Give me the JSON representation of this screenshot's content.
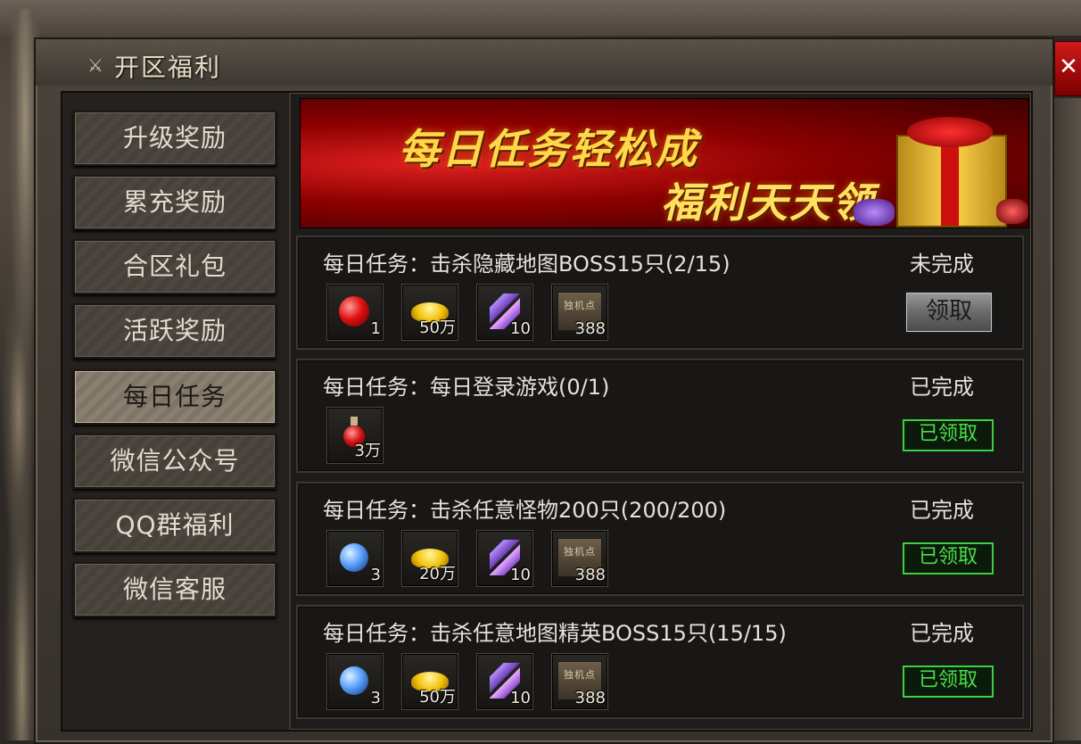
{
  "window": {
    "title": "开区福利",
    "close_label": "✕"
  },
  "sidebar": {
    "items": [
      {
        "label": "升级奖励"
      },
      {
        "label": "累充奖励"
      },
      {
        "label": "合区礼包"
      },
      {
        "label": "活跃奖励"
      },
      {
        "label": "每日任务",
        "active": true
      },
      {
        "label": "微信公众号"
      },
      {
        "label": "QQ群福利"
      },
      {
        "label": "微信客服"
      }
    ]
  },
  "banner": {
    "line1": "每日任务轻松成",
    "line2": "福利天天领"
  },
  "tasks": [
    {
      "title": "每日任务：击杀隐藏地图BOSS15只(2/15)",
      "status": "未完成",
      "button": "领取",
      "claimed": false,
      "rewards": [
        {
          "icon": "red-orb-icon",
          "count": "1"
        },
        {
          "icon": "gold-coins-icon",
          "count": "50万"
        },
        {
          "icon": "purple-scroll-icon",
          "count": "10"
        },
        {
          "icon": "stone-tablet-icon",
          "count": "388",
          "label": "独机点"
        }
      ]
    },
    {
      "title": "每日任务：每日登录游戏(0/1)",
      "status": "已完成",
      "button": "已领取",
      "claimed": true,
      "rewards": [
        {
          "icon": "red-potion-icon",
          "count": "3万"
        }
      ]
    },
    {
      "title": "每日任务：击杀任意怪物200只(200/200)",
      "status": "已完成",
      "button": "已领取",
      "claimed": true,
      "rewards": [
        {
          "icon": "blue-orb-icon",
          "count": "3"
        },
        {
          "icon": "gold-coins-icon",
          "count": "20万"
        },
        {
          "icon": "purple-scroll-icon",
          "count": "10"
        },
        {
          "icon": "stone-tablet-icon",
          "count": "388",
          "label": "独机点"
        }
      ]
    },
    {
      "title": "每日任务：击杀任意地图精英BOSS15只(15/15)",
      "status": "已完成",
      "button": "已领取",
      "claimed": true,
      "rewards": [
        {
          "icon": "blue-orb-icon",
          "count": "3"
        },
        {
          "icon": "gold-coins-icon",
          "count": "50万"
        },
        {
          "icon": "purple-scroll-icon",
          "count": "10"
        },
        {
          "icon": "stone-tablet-icon",
          "count": "388",
          "label": "独机点"
        }
      ]
    }
  ],
  "colors": {
    "claimed_border": "#3ad13a",
    "banner_red": "#8b0000",
    "banner_gold": "#ffd84a"
  }
}
